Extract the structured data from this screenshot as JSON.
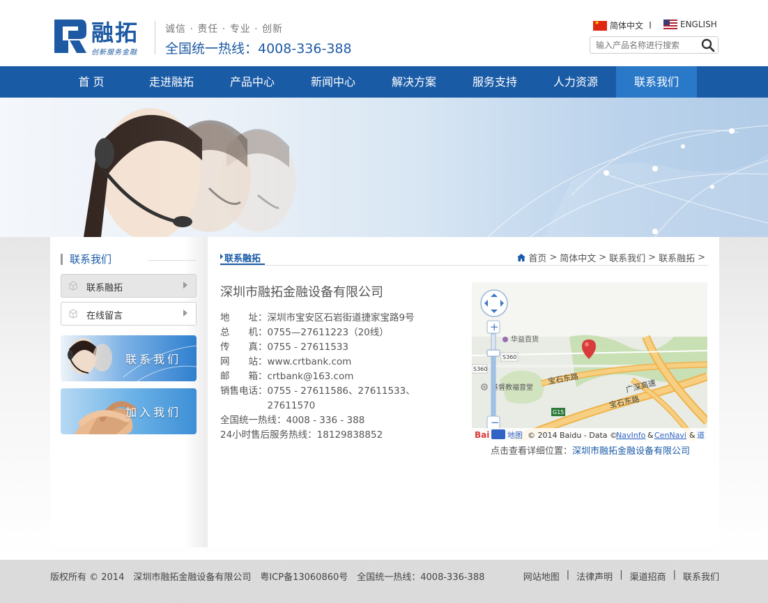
{
  "header": {
    "logo_name": "融拓",
    "logo_sub": "创新服务金融",
    "slogan": "诚信 · 责任 · 专业 · 创新",
    "hotline": "全国统一热线：4008-336-388",
    "lang_cn": "简体中文",
    "lang_en": "ENGLISH",
    "search_placeholder": "输入产品名称进行搜索"
  },
  "nav": {
    "items": [
      "首 页",
      "走进融拓",
      "产品中心",
      "新闻中心",
      "解决方案",
      "服务支持",
      "人力资源",
      "联系我们"
    ],
    "active_index": 7
  },
  "sidebar": {
    "title": "联系我们",
    "items": [
      "联系融拓",
      "在线留言"
    ],
    "banners": [
      "联系我们",
      "加入我们"
    ]
  },
  "content": {
    "section_title": "联系融拓",
    "breadcrumb": [
      "首页",
      "简体中文",
      "联系我们",
      "联系融拓"
    ],
    "company_name": "深圳市融拓金融设备有限公司",
    "info_lines": [
      "地　　址：深圳市宝安区石岩街道捷家宝路9号",
      "总　　机：0755—27611223（20线）",
      "传　　真：0755 - 27611533",
      "网　　站：www.crtbank.com",
      "邮　　箱：crtbank@163.com",
      "销售电话：0755 - 27611586、27611533、",
      "　　　　　27611570",
      "全国统一热线：4008 - 336 - 388",
      "24小时售后服务热线：18129838852"
    ],
    "map": {
      "labels": [
        "华益百货",
        "S360",
        "S360",
        "宝石东路",
        "宝石东路",
        "广深高速",
        "G15",
        "基督教福音堂"
      ],
      "attribution": "© 2014 Baidu - Data ©",
      "navinfo": "NavInfo",
      "cennavi": "CenNavi",
      "more": "道",
      "logo": "Bai",
      "logo_map": "地图"
    },
    "map_caption_prefix": "点击查看详细位置：",
    "map_caption_link": "深圳市融拓金融设备有限公司"
  },
  "footer": {
    "copyright": "版权所有 © 2014　深圳市融拓金融设备有限公司　粤ICP备13060860号　全国统一热线：4008-336-388",
    "links": [
      "网站地图",
      "法律声明",
      "渠道招商",
      "联系我们"
    ]
  },
  "colors": {
    "brand": "#1a5ba6",
    "nav_active": "#2a78c8",
    "map_road": "#f0b24a"
  }
}
